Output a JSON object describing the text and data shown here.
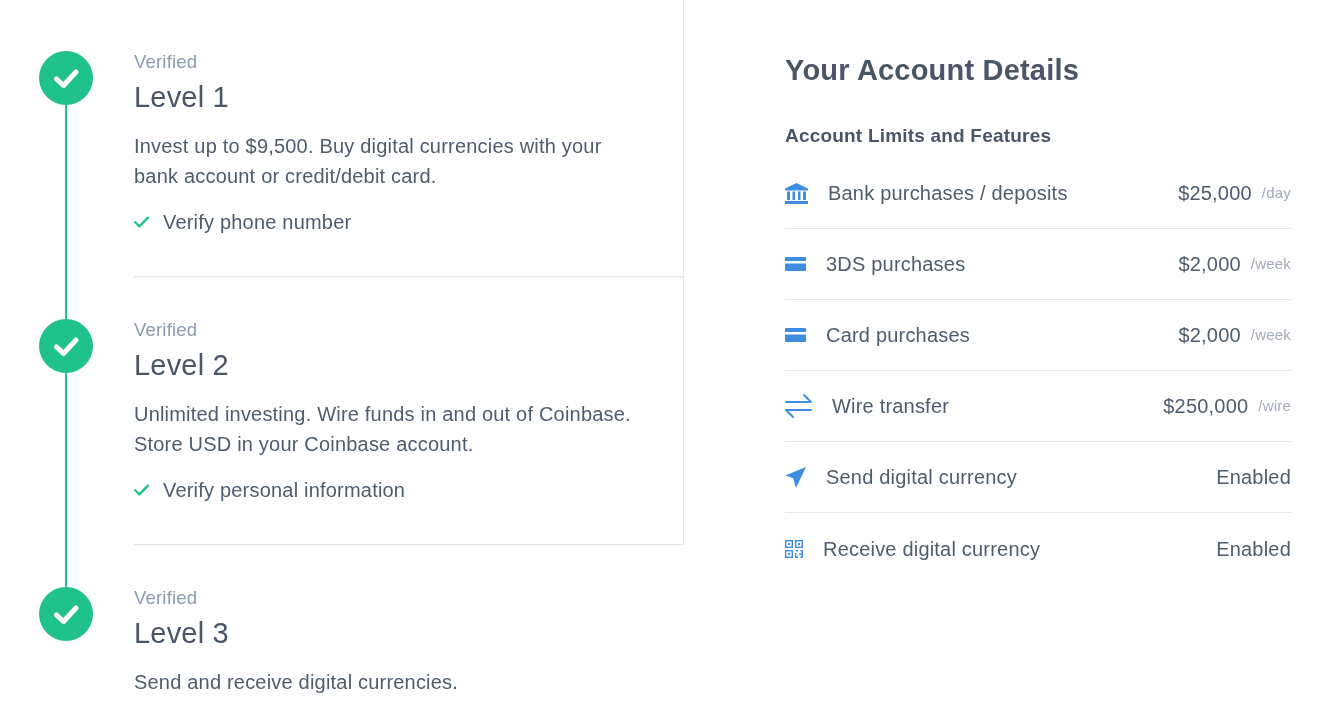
{
  "levels": [
    {
      "status": "Verified",
      "title": "Level 1",
      "completed": true,
      "highlighted": true,
      "description": "Invest up to $9,500. Buy digital currencies with your bank account or credit/debit card.",
      "requirements": [
        {
          "label": "Verify phone number",
          "checked": true
        }
      ]
    },
    {
      "status": "Verified",
      "title": "Level 2",
      "completed": true,
      "highlighted": true,
      "description": "Unlimited investing. Wire funds in and out of Coinbase. Store USD in your Coinbase account.",
      "requirements": [
        {
          "label": "Verify personal information",
          "checked": true
        }
      ]
    },
    {
      "status": "Verified",
      "title": "Level 3",
      "completed": true,
      "highlighted": false,
      "description": "Send and receive digital currencies."
    }
  ],
  "account_details": {
    "title": "Your Account Details",
    "section_title": "Account Limits and Features",
    "limits": [
      {
        "kind": "bank",
        "label": "Bank purchases / deposits",
        "value": "$25,000",
        "unit": "/day"
      },
      {
        "kind": "card",
        "label": "3DS purchases",
        "value": "$2,000",
        "unit": "/week"
      },
      {
        "kind": "card",
        "label": "Card purchases",
        "value": "$2,000",
        "unit": "/week"
      },
      {
        "kind": "transfer",
        "label": "Wire transfer",
        "value": "$250,000",
        "unit": "/wire"
      },
      {
        "kind": "send",
        "label": "Send digital currency",
        "value": "Enabled"
      },
      {
        "kind": "qr",
        "label": "Receive digital currency",
        "value": "Enabled"
      }
    ]
  }
}
